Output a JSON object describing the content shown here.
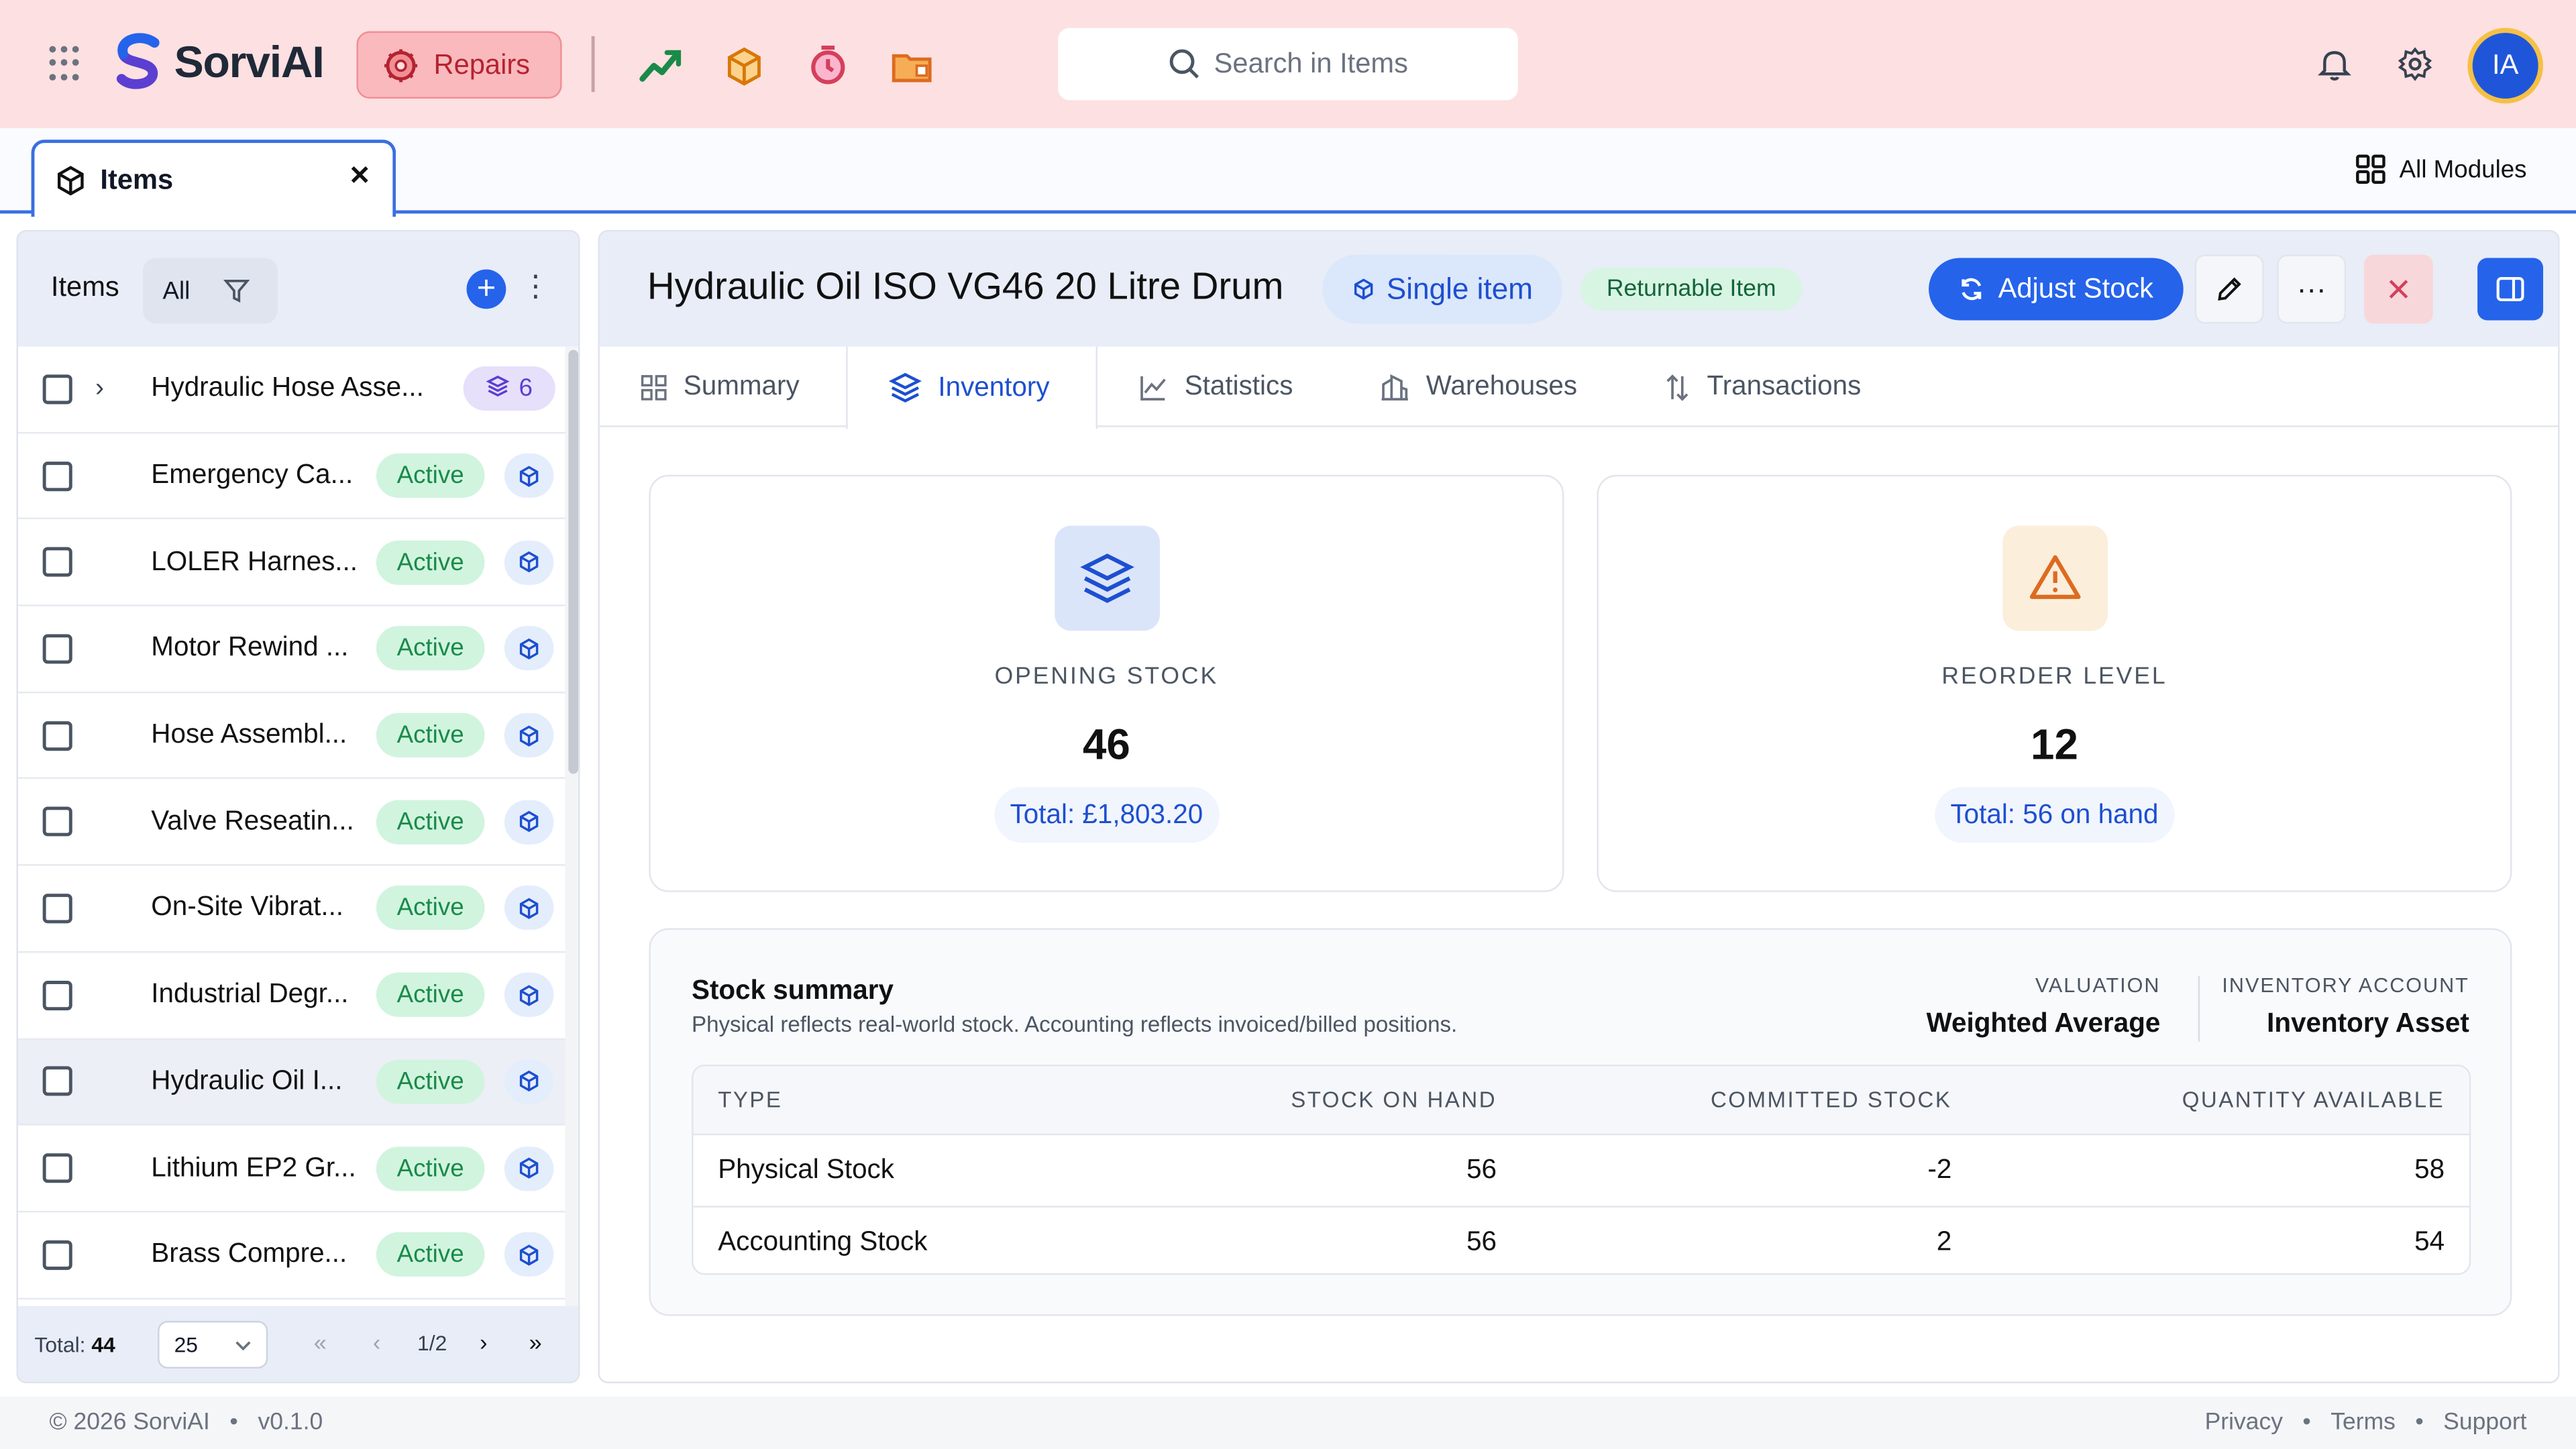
{
  "app": {
    "name": "SorviAI",
    "module_button": "Repairs",
    "colors": {
      "topbar": "#fde0e1",
      "accent": "#2563eb",
      "active_green": "#1a8a48"
    }
  },
  "search": {
    "placeholder": "Search in Items"
  },
  "user": {
    "initials": "IA"
  },
  "tabs": {
    "open_tab": "Items",
    "all_modules": "All Modules"
  },
  "list": {
    "title": "Items",
    "filter_label": "All",
    "items": [
      {
        "name": "Hydraulic Hose Asse...",
        "group_count": "6"
      },
      {
        "name": "Emergency Ca...",
        "status": "Active"
      },
      {
        "name": "LOLER Harnes...",
        "status": "Active"
      },
      {
        "name": "Motor Rewind ...",
        "status": "Active"
      },
      {
        "name": "Hose Assembl...",
        "status": "Active"
      },
      {
        "name": "Valve Reseatin...",
        "status": "Active"
      },
      {
        "name": "On-Site Vibrat...",
        "status": "Active"
      },
      {
        "name": "Industrial Degr...",
        "status": "Active"
      },
      {
        "name": "Hydraulic Oil I...",
        "status": "Active"
      },
      {
        "name": "Lithium EP2 Gr...",
        "status": "Active"
      },
      {
        "name": "Brass Compre...",
        "status": "Active"
      }
    ],
    "footer": {
      "total_label": "Total:",
      "total_value": "44",
      "page_size": "25",
      "page": "1/2"
    }
  },
  "detail": {
    "title": "Hydraulic Oil ISO VG46 20 Litre Drum",
    "type_chip": "Single item",
    "return_chip": "Returnable Item",
    "adjust_button": "Adjust Stock",
    "tabs": [
      "Summary",
      "Inventory",
      "Statistics",
      "Warehouses",
      "Transactions"
    ],
    "active_tab": "Inventory",
    "opening_stock": {
      "label": "OPENING STOCK",
      "value": "46",
      "total": "Total: £1,803.20"
    },
    "reorder_level": {
      "label": "REORDER LEVEL",
      "value": "12",
      "total": "Total: 56 on hand"
    },
    "stock_summary": {
      "title": "Stock summary",
      "subtitle": "Physical reflects real-world stock. Accounting reflects invoiced/billed positions.",
      "valuation_label": "VALUATION",
      "valuation_value": "Weighted Average",
      "account_label": "INVENTORY ACCOUNT",
      "account_value": "Inventory Asset",
      "columns": [
        "TYPE",
        "STOCK ON HAND",
        "COMMITTED STOCK",
        "QUANTITY AVAILABLE"
      ],
      "rows": [
        [
          "Physical Stock",
          "56",
          "-2",
          "58"
        ],
        [
          "Accounting Stock",
          "56",
          "2",
          "54"
        ]
      ]
    }
  },
  "footer": {
    "copyright": "© 2026 SorviAI",
    "version": "v0.1.0",
    "links": [
      "Privacy",
      "Terms",
      "Support"
    ]
  }
}
